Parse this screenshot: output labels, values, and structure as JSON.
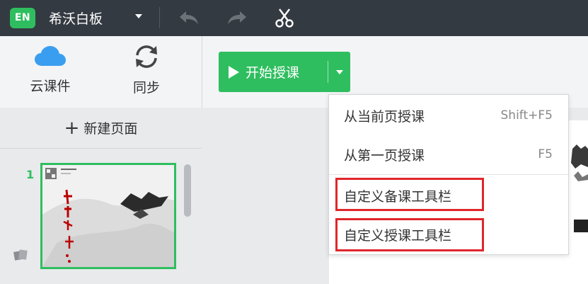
{
  "titlebar": {
    "logo_text": "EN",
    "app_title": "希沃白板",
    "icons": [
      "undo-icon",
      "redo-icon",
      "scissors-icon"
    ]
  },
  "toolbar": {
    "cloud_label": "云课件",
    "sync_label": "同步",
    "start_label": "开始授课"
  },
  "left_panel": {
    "new_page_label": "新建页面",
    "page_number": "1"
  },
  "dropdown": {
    "items": [
      {
        "label": "从当前页授课",
        "shortcut": "Shift+F5"
      },
      {
        "label": "从第一页授课",
        "shortcut": "F5"
      },
      {
        "label": "自定义备课工具栏",
        "shortcut": ""
      },
      {
        "label": "自定义授课工具栏",
        "shortcut": ""
      }
    ]
  },
  "colors": {
    "accent": "#2fbe5f",
    "titlebar": "#343a41",
    "highlight": "#e0262b",
    "cloud": "#3a9ef0"
  }
}
